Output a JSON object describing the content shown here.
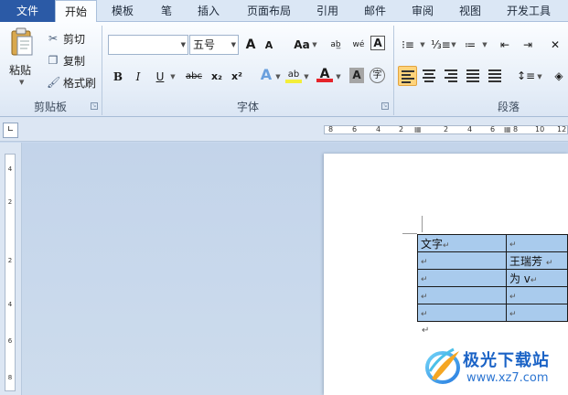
{
  "menu": {
    "file": "文件",
    "tabs": [
      "开始",
      "模板",
      "笔",
      "插入",
      "页面布局",
      "引用",
      "邮件",
      "审阅",
      "视图",
      "开发工具"
    ],
    "active_tab": "开始"
  },
  "clipboard": {
    "paste": "粘贴",
    "cut": "剪切",
    "copy": "复制",
    "format_painter": "格式刷",
    "group_label": "剪贴板"
  },
  "font": {
    "font_name": "",
    "font_size": "五号",
    "group_label": "字体",
    "grow": "A",
    "shrink": "A",
    "change_case": "Aa",
    "bold": "B",
    "italic": "I",
    "underline": "U",
    "strike": "abc",
    "subscript": "x₂",
    "superscript": "x²",
    "highlight": "ab",
    "font_color": "A"
  },
  "paragraph": {
    "group_label": "段落"
  },
  "ruler": {
    "horizontal_numbers": [
      "8",
      "6",
      "4",
      "2",
      "2",
      "4",
      "6",
      "8",
      "10",
      "12"
    ],
    "vertical_numbers": [
      "4",
      "2",
      "2",
      "4",
      "6",
      "8"
    ]
  },
  "document": {
    "table": [
      [
        "文字",
        ""
      ],
      [
        "",
        "王瑞芳"
      ],
      [
        "",
        "为 v"
      ],
      [
        "",
        ""
      ],
      [
        "",
        ""
      ]
    ],
    "para_mark": "↵"
  },
  "watermark": {
    "text": "极光下载站",
    "url": "www.xz7.com"
  },
  "colors": {
    "file_tab": "#2b5aa6",
    "table_fill": "#a9cbed",
    "active_align": "#ffd37b",
    "workspace": "#c3d4ea"
  }
}
